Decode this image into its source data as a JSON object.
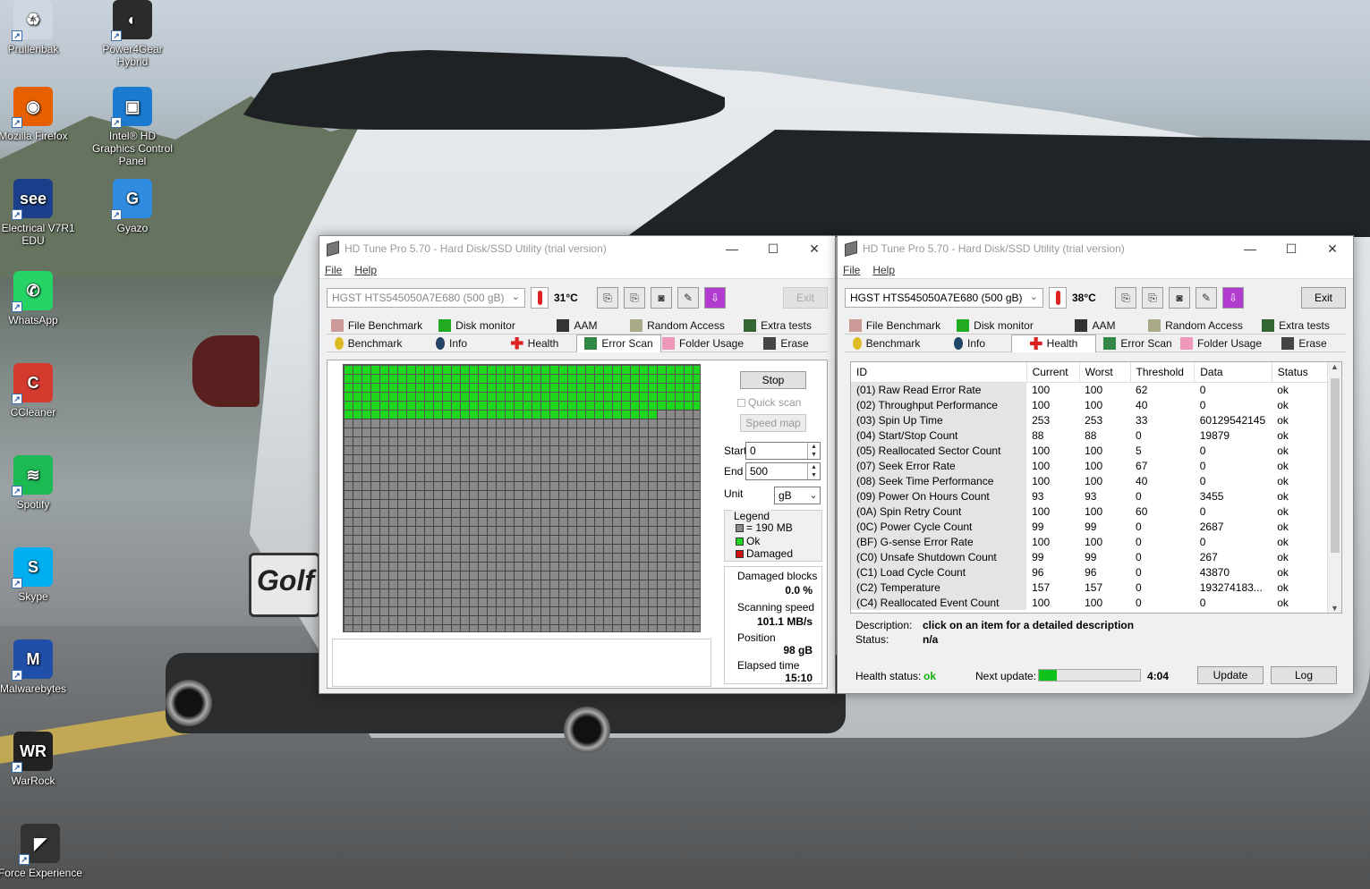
{
  "desktop": {
    "icons": [
      {
        "label": "Prullenbak",
        "glyph": "♻",
        "color": "#cfd8e2"
      },
      {
        "label": "Power4Gear Hybrid",
        "glyph": "◐",
        "color": "#2b2b2b"
      },
      {
        "label": "Mozilla Firefox",
        "glyph": "◉",
        "color": "#e66000"
      },
      {
        "label": "Intel® HD Graphics Control Panel",
        "glyph": "▣",
        "color": "#1a7bd0"
      },
      {
        "label": "E Electrical V7R1 EDU",
        "glyph": "see",
        "color": "#1b3f8a"
      },
      {
        "label": "Gyazo",
        "glyph": "G",
        "color": "#2f8ce0"
      },
      {
        "label": "WhatsApp",
        "glyph": "✆",
        "color": "#25d366"
      },
      {
        "label": "CCleaner",
        "glyph": "C",
        "color": "#d53a2f"
      },
      {
        "label": "Spotify",
        "glyph": "≋",
        "color": "#1db954"
      },
      {
        "label": "Skype",
        "glyph": "S",
        "color": "#00aff0"
      },
      {
        "label": "Malwarebytes",
        "glyph": "M",
        "color": "#1f4fa8"
      },
      {
        "label": "WarRock",
        "glyph": "WR",
        "color": "#222222"
      },
      {
        "label": "Force Experience",
        "glyph": "◤",
        "color": "#333333"
      }
    ]
  },
  "win1": {
    "title": "HD Tune Pro 5.70 - Hard Disk/SSD Utility (trial version)",
    "menu": [
      "File",
      "Help"
    ],
    "drive": "HGST HTS545050A7E680 (500 gB)",
    "temp": "31°C",
    "exit": "Exit",
    "tabs_row1": [
      "File Benchmark",
      "Disk monitor",
      "AAM",
      "Random Access",
      "Extra tests"
    ],
    "tabs_row2": [
      "Benchmark",
      "Info",
      "Health",
      "Error Scan",
      "Folder Usage",
      "Erase"
    ],
    "active_tab": "Error Scan",
    "scan": {
      "stop": "Stop",
      "quick_scan": "Quick scan",
      "speed_map": "Speed map",
      "start_label": "Start",
      "start_value": "0",
      "end_label": "End",
      "end_value": "500",
      "unit_label": "Unit",
      "unit_value": "gB",
      "legend_title": "Legend",
      "legend_block": "= 190 MB",
      "legend_ok": "Ok",
      "legend_damaged": "Damaged",
      "damaged_blocks_label": "Damaged blocks",
      "damaged_blocks_value": "0.0 %",
      "scanning_speed_label": "Scanning speed",
      "scanning_speed_value": "101.1 MB/s",
      "position_label": "Position",
      "position_value": "98 gB",
      "elapsed_label": "Elapsed time",
      "elapsed_value": "15:10",
      "scanned_fraction": 0.196,
      "color_ok": "#1fd61f",
      "color_unscanned": "#8a8a8a",
      "color_damaged": "#d01010"
    }
  },
  "win2": {
    "title": "HD Tune Pro 5.70 - Hard Disk/SSD Utility (trial version)",
    "menu": [
      "File",
      "Help"
    ],
    "drive": "HGST HTS545050A7E680 (500 gB)",
    "temp": "38°C",
    "exit": "Exit",
    "tabs_row1": [
      "File Benchmark",
      "Disk monitor",
      "AAM",
      "Random Access",
      "Extra tests"
    ],
    "tabs_row2": [
      "Benchmark",
      "Info",
      "Health",
      "Error Scan",
      "Folder Usage",
      "Erase"
    ],
    "active_tab": "Health",
    "health": {
      "columns": [
        "ID",
        "Current",
        "Worst",
        "Threshold",
        "Data",
        "Status"
      ],
      "rows": [
        [
          "(01) Raw Read Error Rate",
          "100",
          "100",
          "62",
          "0",
          "ok"
        ],
        [
          "(02) Throughput Performance",
          "100",
          "100",
          "40",
          "0",
          "ok"
        ],
        [
          "(03) Spin Up Time",
          "253",
          "253",
          "33",
          "60129542145",
          "ok"
        ],
        [
          "(04) Start/Stop Count",
          "88",
          "88",
          "0",
          "19879",
          "ok"
        ],
        [
          "(05) Reallocated Sector Count",
          "100",
          "100",
          "5",
          "0",
          "ok"
        ],
        [
          "(07) Seek Error Rate",
          "100",
          "100",
          "67",
          "0",
          "ok"
        ],
        [
          "(08) Seek Time Performance",
          "100",
          "100",
          "40",
          "0",
          "ok"
        ],
        [
          "(09) Power On Hours Count",
          "93",
          "93",
          "0",
          "3455",
          "ok"
        ],
        [
          "(0A) Spin Retry Count",
          "100",
          "100",
          "60",
          "0",
          "ok"
        ],
        [
          "(0C) Power Cycle Count",
          "99",
          "99",
          "0",
          "2687",
          "ok"
        ],
        [
          "(BF) G-sense Error Rate",
          "100",
          "100",
          "0",
          "0",
          "ok"
        ],
        [
          "(C0) Unsafe Shutdown Count",
          "99",
          "99",
          "0",
          "267",
          "ok"
        ],
        [
          "(C1) Load Cycle Count",
          "96",
          "96",
          "0",
          "43870",
          "ok"
        ],
        [
          "(C2) Temperature",
          "157",
          "157",
          "0",
          "193274183...",
          "ok"
        ],
        [
          "(C4) Reallocated Event Count",
          "100",
          "100",
          "0",
          "0",
          "ok"
        ]
      ],
      "description_label": "Description:",
      "description_value": "click on an item for a detailed description",
      "status_label": "Status:",
      "status_value": "n/a",
      "health_status_label": "Health status:",
      "health_status_value": "ok",
      "next_update_label": "Next update:",
      "next_update_value": "4:04",
      "next_update_progress": 0.18,
      "update_button": "Update",
      "log_button": "Log"
    }
  }
}
